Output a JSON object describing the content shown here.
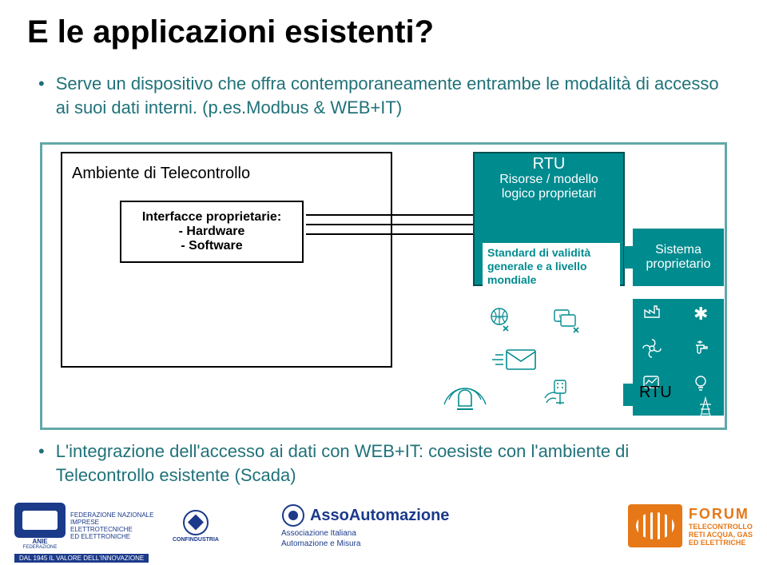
{
  "title": "E le applicazioni esistenti?",
  "bullet1": "Serve un dispositivo che offra contemporaneamente entrambe le modalità di accesso ai suoi dati interni. (p.es.Modbus & WEB+IT)",
  "env_title": "Ambiente di Telecontrollo",
  "if_l1": "Interfacce proprietarie:",
  "if_l2": "- Hardware",
  "if_l3": "- Software",
  "rtu": {
    "label": "RTU",
    "sub1": "Risorse / modello",
    "sub2": "logico proprietari",
    "white1": "Standard di validità",
    "white2": "generale e a livello",
    "white3": "mondiale"
  },
  "sys1": "Sistema",
  "sys2": "proprietario",
  "rtu2": "RTU",
  "bullet2": "L'integrazione dell'accesso ai dati con WEB+IT: coesiste con l'ambiente di Telecontrollo esistente (Scada)",
  "footer": {
    "anie_t": "ANIE",
    "anie_sub": "FEDERAZIONE",
    "anie_d1": "FEDERAZIONE NAZIONALE",
    "anie_d2": "IMPRESE ELETTROTECNICHE",
    "anie_d3": "ED ELETTRONICHE",
    "anie_y": "DAL 1945 IL VALORE DELL'INNOVAZIONE",
    "conf": "CONFINDUSTRIA",
    "asso": "AssoAutomazione",
    "asso_s1": "Associazione Italiana",
    "asso_s2": "Automazione e Misura",
    "forum": "FORUM",
    "forum_s1": "TELECONTROLLO",
    "forum_s2": "RETI ACQUA, GAS",
    "forum_s3": "ED ELETTRICHE"
  }
}
